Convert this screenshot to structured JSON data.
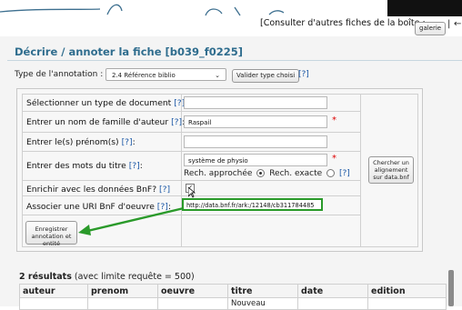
{
  "header": {
    "consult_text": "[Consulter d'autres fiches de la boîte :",
    "galerie_label": "galerie",
    "pipe": "|",
    "arrow": "←"
  },
  "page_title": "Décrire / annoter la fiche [b039_f0225]",
  "annotation_type": {
    "label": "Type de l'annotation :",
    "selected": "2.4 Référence biblio",
    "validate_label": "Valider type choisi",
    "help": "[?]"
  },
  "form": {
    "rows": [
      {
        "label": "Sélectionner un type de document",
        "help": "[?]",
        "suffix": ":",
        "value": ""
      },
      {
        "label": "Entrer un nom de famille d'auteur",
        "help": "[?]",
        "suffix": ":",
        "value": "Raspail",
        "required": "*"
      },
      {
        "label": "Entrer le(s) prénom(s)",
        "help": "[?]",
        "suffix": ":",
        "value": ""
      },
      {
        "label": "Entrer des mots du titre",
        "help": "[?]",
        "suffix": ":",
        "value": "système de physio",
        "required": "*"
      },
      {
        "label": "Enrichir avec les données BnF?",
        "help": "[?]",
        "suffix": "",
        "checked": "✓"
      },
      {
        "label": "Associer une URI BnF d'oeuvre",
        "help": "[?]",
        "suffix": ":",
        "value": "http://data.bnf.fr/ark:/12148/cb311784485"
      }
    ],
    "search_mode": {
      "approx_label": "Rech. approchée",
      "exact_label": "Rech. exacte",
      "help": "[?]"
    },
    "chercher_label": "Chercher un alignement sur data.bnf",
    "save_label": "Enregistrer annotation et entité"
  },
  "results": {
    "count_text": "2 résultats",
    "limit_text": "(avec limite requête = 500)",
    "columns": [
      "auteur",
      "prenom",
      "oeuvre",
      "titre",
      "date",
      "edition"
    ],
    "first_row": {
      "auteur": "",
      "prenom": "",
      "oeuvre": "",
      "titre": "Nouveau",
      "date": "",
      "edition": ""
    }
  },
  "colors": {
    "title": "#2f6d8e",
    "highlight": "#2a9a2a",
    "required": "#dd0000",
    "help_link": "#1a57a6"
  }
}
